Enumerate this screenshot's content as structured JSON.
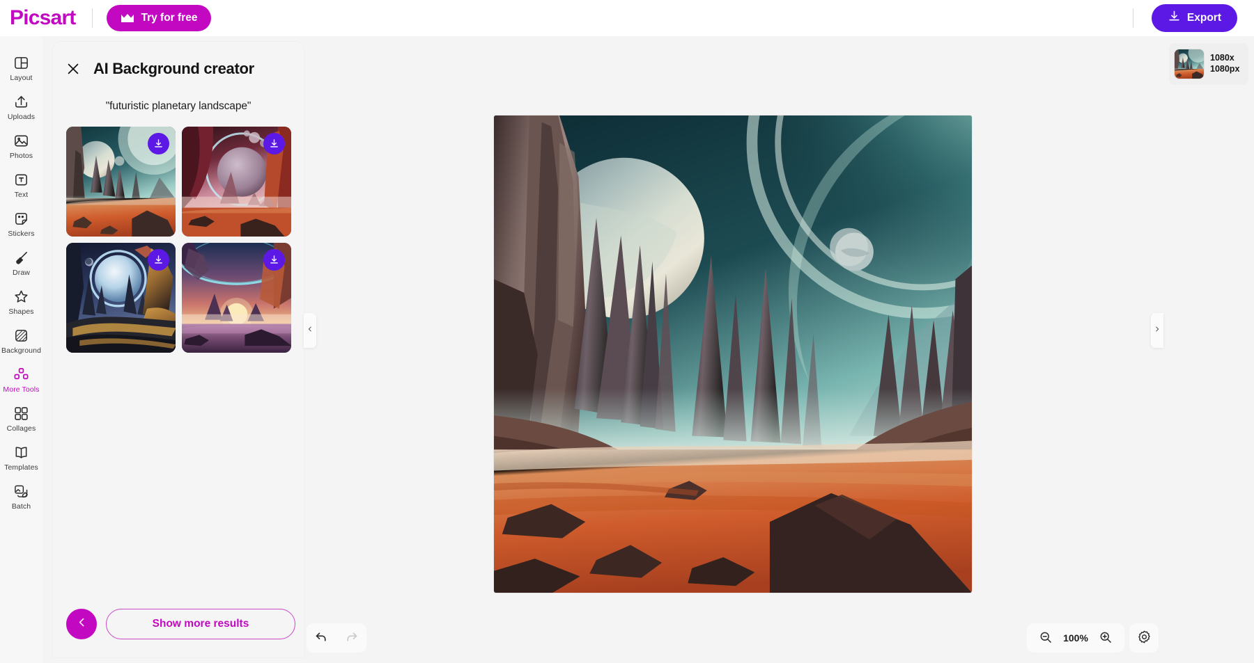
{
  "topbar": {
    "brand": "Picsart",
    "try_free_label": "Try for free",
    "try_free_icon": "crown-icon",
    "export_label": "Export",
    "export_icon": "download-icon",
    "accent_magenta": "#c209c1",
    "accent_purple": "#5c19e6"
  },
  "sidebar": {
    "items": [
      {
        "label": "Layout",
        "icon": "layout-icon",
        "active": false
      },
      {
        "label": "Uploads",
        "icon": "upload-icon",
        "active": false
      },
      {
        "label": "Photos",
        "icon": "photos-icon",
        "active": false
      },
      {
        "label": "Text",
        "icon": "text-icon",
        "active": false
      },
      {
        "label": "Stickers",
        "icon": "stickers-icon",
        "active": false
      },
      {
        "label": "Draw",
        "icon": "brush-icon",
        "active": false
      },
      {
        "label": "Shapes",
        "icon": "star-icon",
        "active": false
      },
      {
        "label": "Background",
        "icon": "background-icon",
        "active": false
      },
      {
        "label": "More Tools",
        "icon": "more-tools-icon",
        "active": true
      },
      {
        "label": "Collages",
        "icon": "collages-icon",
        "active": false
      },
      {
        "label": "Templates",
        "icon": "templates-icon",
        "active": false
      },
      {
        "label": "Batch",
        "icon": "batch-icon",
        "active": false
      }
    ]
  },
  "panel": {
    "close_icon": "close-icon",
    "title": "AI Background creator",
    "prompt": "\"futuristic planetary landscape\"",
    "results": [
      {
        "alt": "generated-background-1",
        "download_icon": "download-icon"
      },
      {
        "alt": "generated-background-2",
        "download_icon": "download-icon"
      },
      {
        "alt": "generated-background-3",
        "download_icon": "download-icon"
      },
      {
        "alt": "generated-background-4",
        "download_icon": "download-icon"
      }
    ],
    "back_icon": "chevron-left-icon",
    "show_more_label": "Show more results"
  },
  "canvas": {
    "collapse_left_icon": "chevron-left-icon",
    "collapse_right_icon": "chevron-right-icon",
    "undo_icon": "undo-icon",
    "redo_icon": "redo-icon",
    "zoom_out_icon": "zoom-out-icon",
    "zoom_in_icon": "zoom-in-icon",
    "zoom_level": "100%",
    "settings_icon": "gear-icon"
  },
  "right_panel": {
    "page": {
      "size_line1": "1080x",
      "size_line2": "1080px",
      "thumb_alt": "page-thumbnail"
    }
  }
}
